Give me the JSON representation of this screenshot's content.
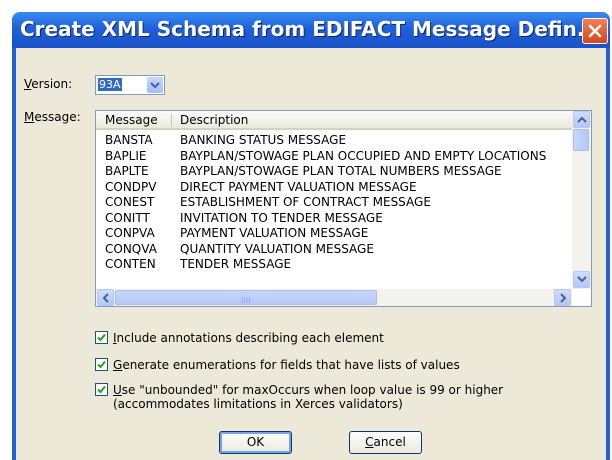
{
  "window": {
    "title": "Create XML Schema from EDIFACT Message Defin..."
  },
  "version": {
    "label_prefix": "",
    "label_u": "V",
    "label_rest": "ersion:",
    "value": "93A"
  },
  "message": {
    "label_u": "M",
    "label_rest": "essage:"
  },
  "list": {
    "columns": [
      "Message",
      "Description"
    ],
    "rows": [
      [
        "BANSTA",
        "BANKING STATUS MESSAGE"
      ],
      [
        "BAPLIE",
        "BAYPLAN/STOWAGE PLAN OCCUPIED AND EMPTY LOCATIONS"
      ],
      [
        "BAPLTE",
        "BAYPLAN/STOWAGE PLAN TOTAL NUMBERS MESSAGE"
      ],
      [
        "CONDPV",
        "DIRECT PAYMENT VALUATION MESSAGE"
      ],
      [
        "CONEST",
        "ESTABLISHMENT OF CONTRACT MESSAGE"
      ],
      [
        "CONITT",
        "INVITATION TO TENDER MESSAGE"
      ],
      [
        "CONPVA",
        "PAYMENT VALUATION MESSAGE"
      ],
      [
        "CONQVA",
        "QUANTITY VALUATION MESSAGE"
      ],
      [
        "CONTEN",
        "TENDER MESSAGE"
      ]
    ],
    "hscroll_grip": "IIII"
  },
  "options": {
    "include_annotations": {
      "u": "I",
      "rest": "nclude annotations describing each element",
      "checked": true
    },
    "generate_enumerations": {
      "u": "G",
      "rest": "enerate enumerations for fields that have lists of values",
      "checked": true
    },
    "use_unbounded": {
      "u": "U",
      "rest": "se \"unbounded\" for maxOccurs when loop value is 99 or higher",
      "line2": "(accommodates limitations in Xerces validators)",
      "checked": true
    }
  },
  "buttons": {
    "ok": "OK",
    "cancel_u": "C",
    "cancel_rest": "ancel"
  },
  "icons": {
    "close": "close-icon",
    "dropdown": "chevron-down-icon",
    "check": "check-icon"
  },
  "colors": {
    "titlebar": "#245edb",
    "dialog_bg": "#ece9d8",
    "selection": "#316ac5",
    "close": "#d8451a"
  }
}
